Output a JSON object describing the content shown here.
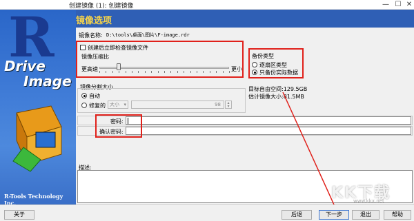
{
  "window": {
    "title": "创建镜像 (1): 创建镜像"
  },
  "brand": {
    "letter": "R",
    "word1": "Drive",
    "word2": "Image",
    "footer": "R-Tools Technology Inc."
  },
  "header": {
    "title": "镜像选项"
  },
  "image_name": {
    "label": "镜像名称:",
    "value": "D:\\tools\\桌面\\图片\\F-image.rdr"
  },
  "verify": {
    "checkbox_label": "创建后立即检查镜像文件",
    "checked": false
  },
  "compression": {
    "label": "镜像压缩比",
    "left_label": "更高速",
    "right_label": "更小",
    "level": 0.15
  },
  "backup_type": {
    "label": "备份类型",
    "options": [
      "逐扇区类型",
      "只备份实际数据"
    ],
    "selected": 1
  },
  "stats": {
    "free_space": "目标自由空间:129.5GB",
    "estimated_size": "估计镜像大小:81.5MB"
  },
  "split": {
    "label": "镜像分割大小",
    "auto_label": "自动",
    "fixed_label": "修复的",
    "size_select": "大小",
    "size_value": "98",
    "selected": "auto"
  },
  "password": {
    "label": "密码:",
    "confirm_label": "确认密码:",
    "value": "",
    "confirm_value": ""
  },
  "description": {
    "label": "描述:"
  },
  "buttons": {
    "about": "关于",
    "back": "后退",
    "next": "下一步",
    "cancel": "退出",
    "help": "帮助"
  },
  "watermark": {
    "text": "KK下载",
    "url": "www.kkx.net"
  },
  "colors": {
    "header_bg": "#2f5fb5",
    "header_title": "#f5d34a",
    "highlight": "#e0201a"
  }
}
